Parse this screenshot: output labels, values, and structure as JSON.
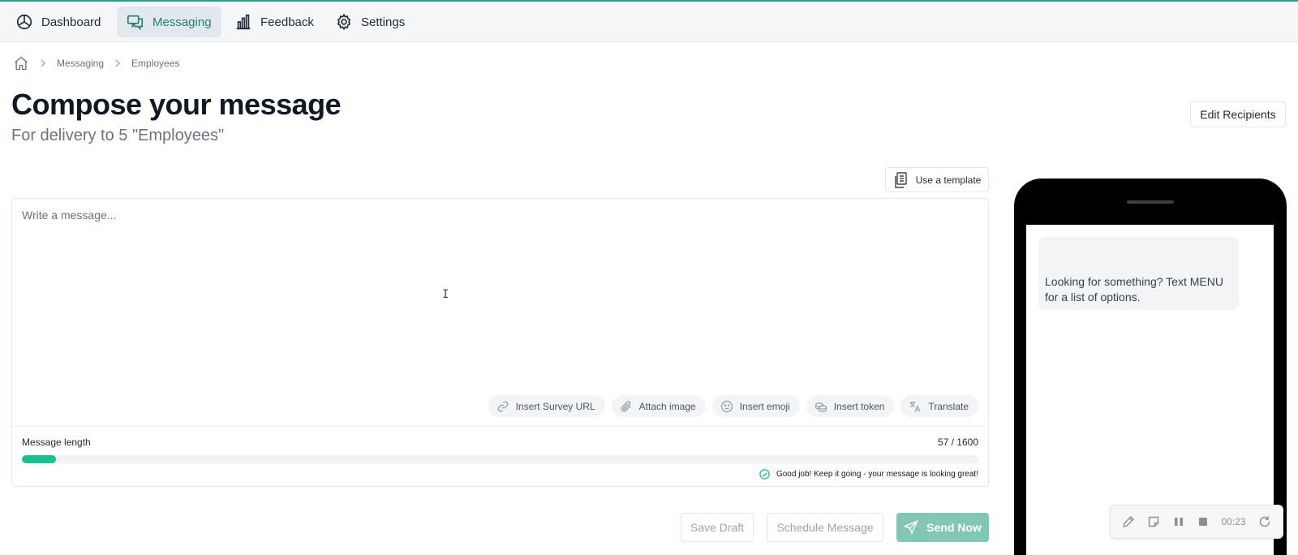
{
  "nav": {
    "items": [
      {
        "label": "Dashboard",
        "icon": "dashboard-icon"
      },
      {
        "label": "Messaging",
        "icon": "chat-icon",
        "active": true
      },
      {
        "label": "Feedback",
        "icon": "bar-chart-icon"
      },
      {
        "label": "Settings",
        "icon": "gear-icon"
      }
    ]
  },
  "breadcrumb": {
    "items": [
      "Messaging",
      "Employees"
    ]
  },
  "page": {
    "title": "Compose your message",
    "subtitle": "For delivery to 5 \"Employees\"",
    "edit_recipients_label": "Edit Recipients",
    "use_template_label": "Use a template"
  },
  "composer": {
    "placeholder": "Write a message...",
    "tools": [
      "Insert Survey URL",
      "Attach image",
      "Insert emoji",
      "Insert token",
      "Translate"
    ],
    "length_label": "Message length",
    "length_count": "57 / 1600",
    "length_value": 57,
    "length_max": 1600,
    "length_fraction": 0.0356,
    "hint": "Good job! Keep it going - your message is looking great!"
  },
  "actions": {
    "save_draft": "Save Draft",
    "schedule": "Schedule Message",
    "send_now": "Send Now"
  },
  "preview": {
    "bubble_text": "Looking for something? Text MENU for a list of options."
  },
  "recorder": {
    "time": "00:23"
  },
  "colors": {
    "accent": "#2f9f8f",
    "progress": "#1cbf8f",
    "send_button": "#82c6b5"
  }
}
